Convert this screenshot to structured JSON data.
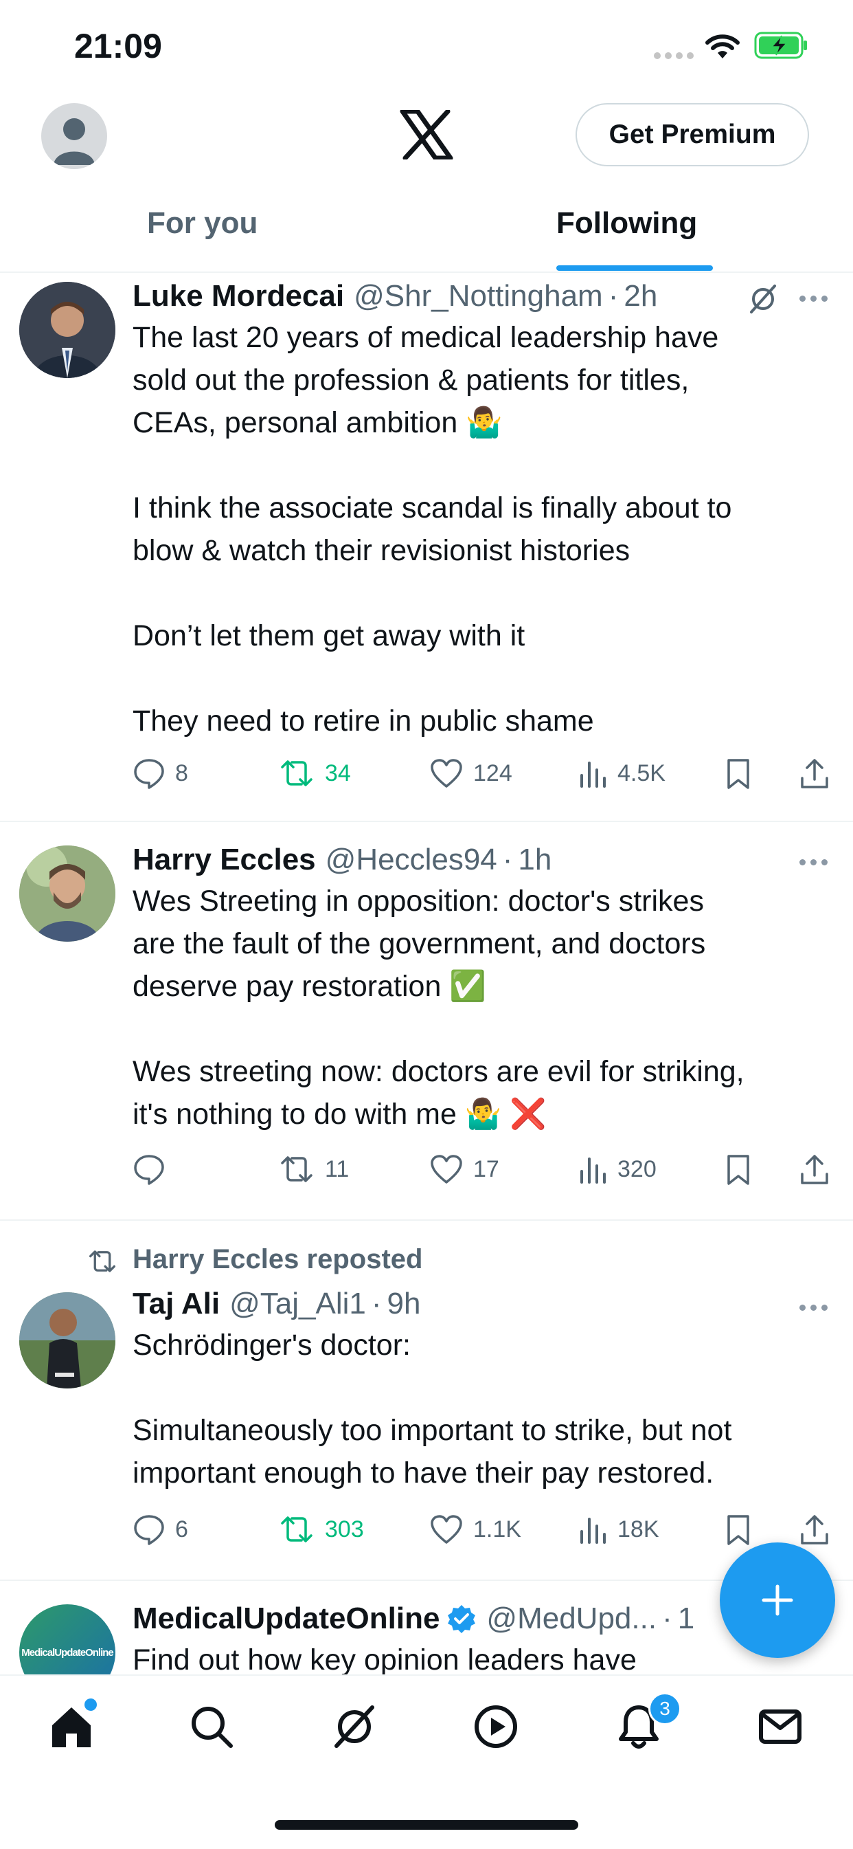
{
  "status_bar": {
    "time": "21:09"
  },
  "header": {
    "premium_label": "Get Premium",
    "tabs": [
      {
        "label": "For you",
        "active": false
      },
      {
        "label": "Following",
        "active": true
      }
    ]
  },
  "posts": [
    {
      "name": "Luke Mordecai",
      "handle": "@Shr_Nottingham",
      "time": "2h",
      "text": "The last 20 years of medical leadership have\nsold out the profession & patients for titles,\nCEAs, personal ambition 🤷‍♂️\n\nI think the associate scandal is finally about to\nblow & watch their revisionist histories\n\nDon’t let them get away with it\n\nThey need to retire in public shame",
      "replies": "8",
      "reposts": "34",
      "likes": "124",
      "views": "4.5K"
    },
    {
      "name": "Harry Eccles",
      "handle": "@Heccles94",
      "time": "1h",
      "text": "Wes Streeting in opposition: doctor's strikes\nare the fault of the government, and doctors\ndeserve pay restoration ✅\n\nWes streeting now: doctors are evil for striking,\nit's nothing to do with me 🤷‍♂️ ❌",
      "replies": "",
      "reposts": "11",
      "likes": "17",
      "views": "320"
    },
    {
      "repost_label": "Harry Eccles reposted",
      "name": "Taj Ali",
      "handle": "@Taj_Ali1",
      "time": "9h",
      "text": "Schrödinger's doctor:\n\nSimultaneously too important to strike, but not\nimportant enough to have their pay restored.",
      "replies": "6",
      "reposts": "303",
      "likes": "1.1K",
      "views": "18K"
    },
    {
      "name": "MedicalUpdateOnline",
      "handle": "@MedUpd...",
      "time": "1",
      "avatar_text": "MedicalUpdateOnline",
      "text": "Find out how key opinion leaders have"
    }
  ],
  "bottom_nav": {
    "items": [
      "home-icon",
      "search-icon",
      "grok-icon",
      "video-icon",
      "notifications-icon",
      "messages-icon"
    ],
    "notification_count": "3"
  },
  "colors": {
    "accent": "#1d9bf0",
    "repost_green": "#00ba7c",
    "secondary_text": "#536471"
  }
}
